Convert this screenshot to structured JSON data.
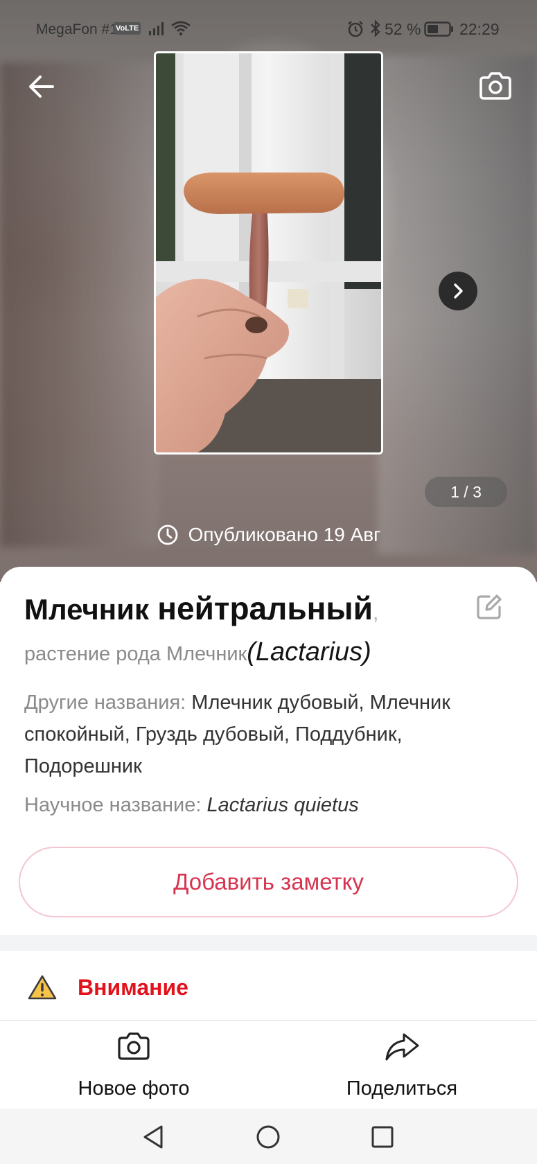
{
  "status_bar": {
    "carrier": "MegaFon #1",
    "volte": "VoLTE",
    "battery_percent": "52 %",
    "time": "22:29"
  },
  "gallery": {
    "counter": "1 / 3",
    "published": "Опубликовано 19 Авг"
  },
  "species": {
    "name_part1": "Млечник",
    "name_part2": "нейтральный",
    "name_comma": ",",
    "genus_prefix": "растение рода Млечник",
    "genus_latin": "(Lactarius)",
    "other_names_label": "Другие названия:",
    "other_names_value": "Млечник дубовый, Млечник спокойный, Груздь дубовый, Поддубник, Подорешник",
    "scientific_label": "Научное название:",
    "scientific_value": "Lactarius quietus"
  },
  "actions": {
    "add_note": "Добавить заметку",
    "attention": "Внимание",
    "new_photo": "Новое фото",
    "share": "Поделиться"
  },
  "colors": {
    "accent": "#d6344f",
    "accent_border": "#f3c6d0",
    "warning": "#e2121d",
    "warning_icon_fill": "#f6c24a"
  },
  "icons": {
    "back": "arrow-left-icon",
    "camera": "camera-icon",
    "next": "chevron-right-icon",
    "clock": "clock-icon",
    "edit": "edit-icon",
    "warning": "warning-icon",
    "share": "share-arrow-icon"
  }
}
